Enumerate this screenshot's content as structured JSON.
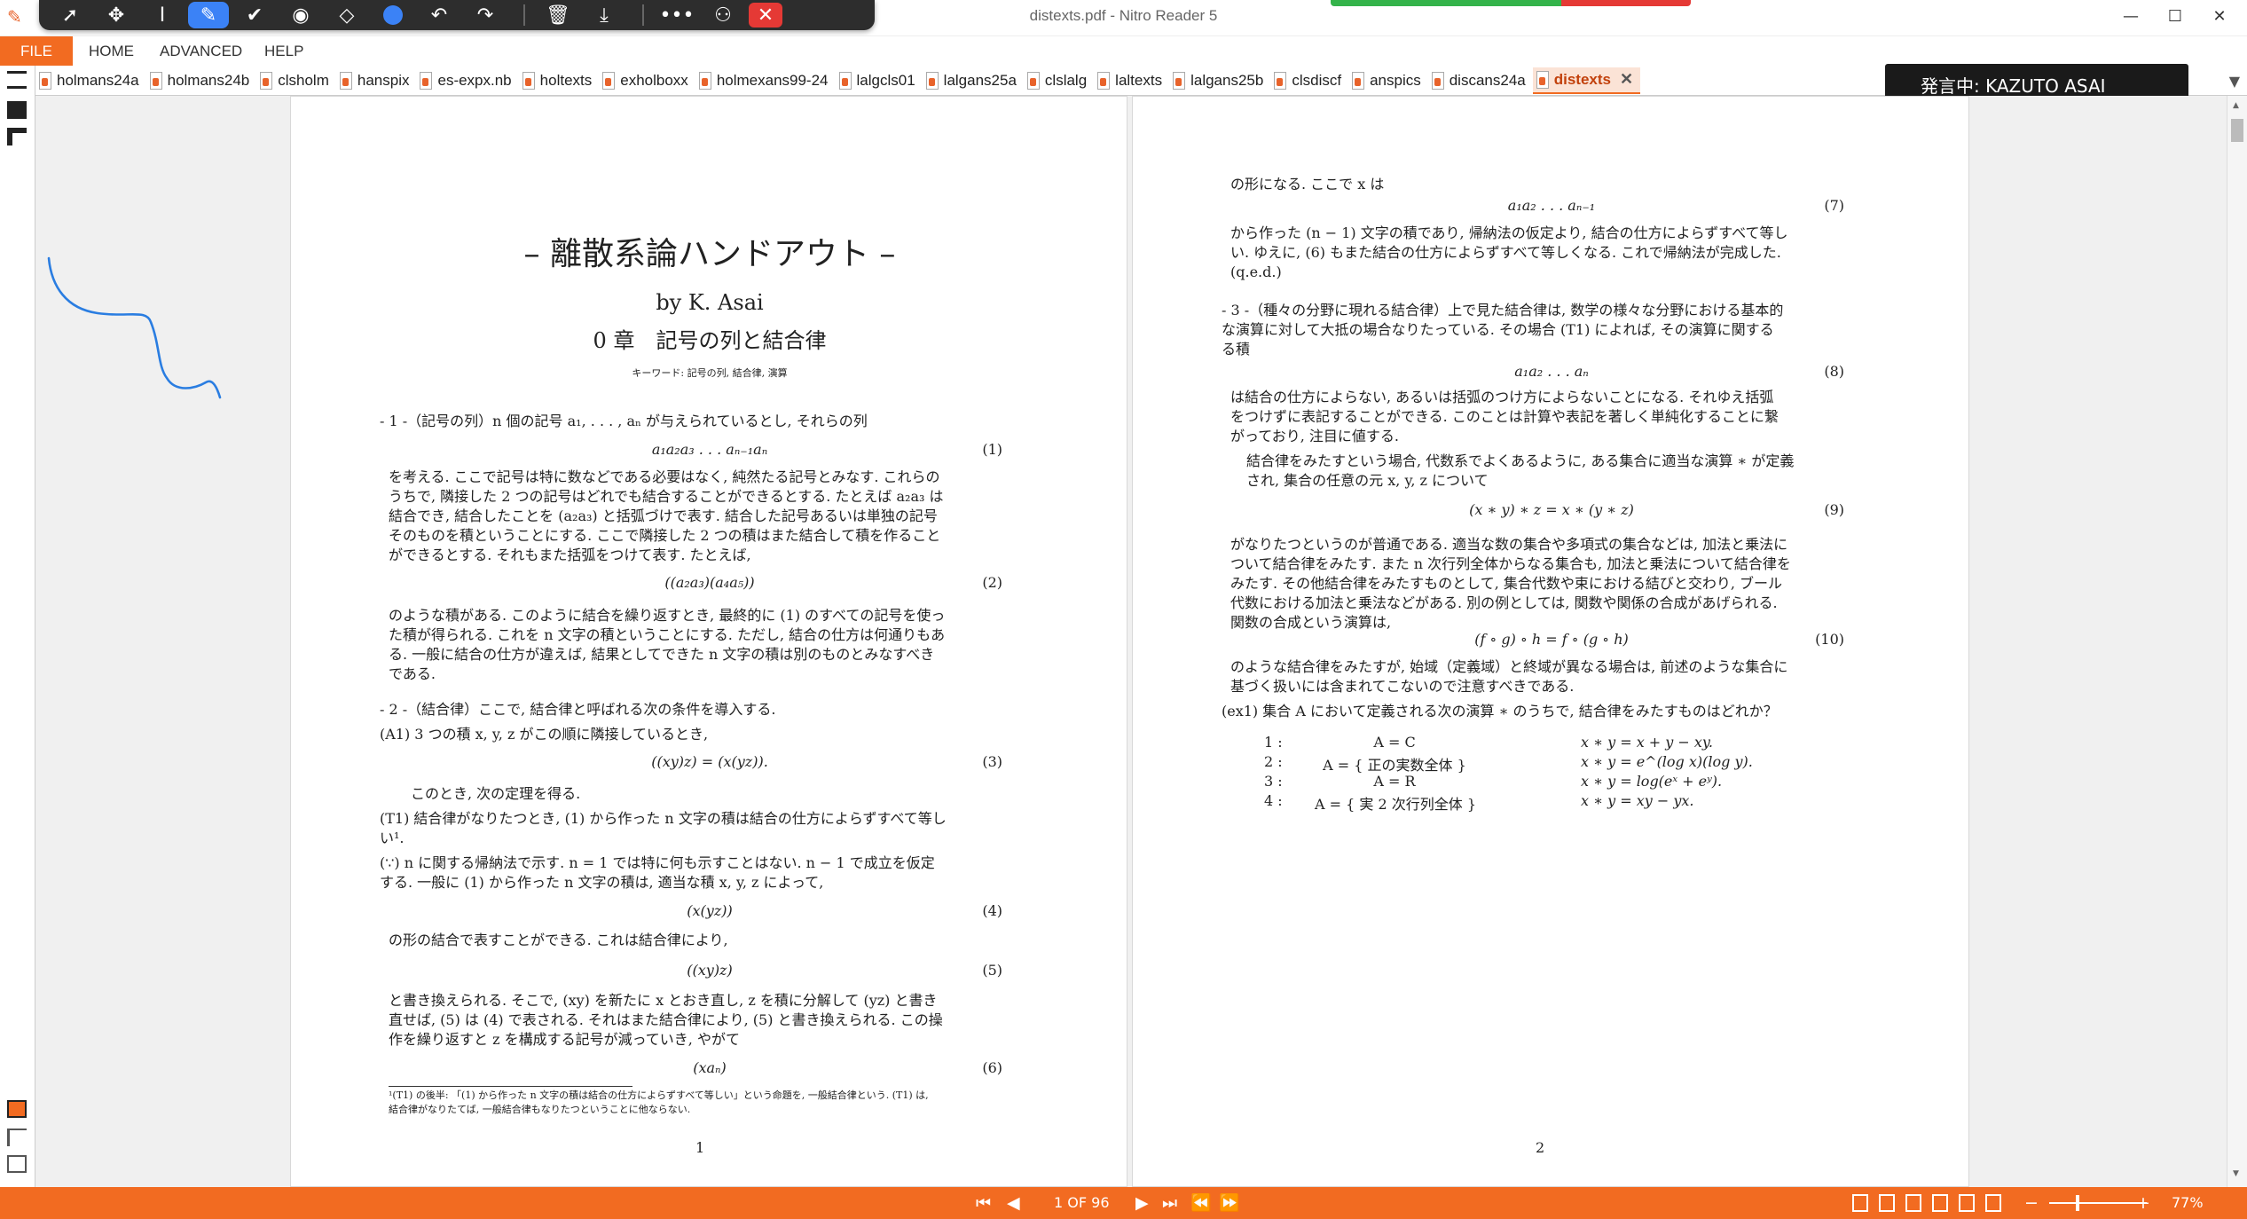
{
  "window": {
    "title": "distexts.pdf - Nitro Reader 5",
    "colors": {
      "accent": "#f26b21",
      "toolbar": "#2d2d2d",
      "green": "#34b34a",
      "red": "#e53935"
    }
  },
  "annotation_toolbar": {
    "tools": [
      "select-icon",
      "move-icon",
      "text-cursor-icon",
      "pen-icon",
      "check-icon",
      "stamp-icon",
      "eraser-icon",
      "color-icon",
      "undo-icon",
      "redo-icon",
      "trash-icon",
      "download-icon",
      "more-icon",
      "share-icon",
      "close-icon"
    ]
  },
  "menu": {
    "file": "FILE",
    "home": "HOME",
    "advanced": "ADVANCED",
    "help": "HELP"
  },
  "tabs": [
    {
      "label": "holmans24a"
    },
    {
      "label": "holmans24b"
    },
    {
      "label": "clsholm"
    },
    {
      "label": "hanspix"
    },
    {
      "label": "es-expx.nb"
    },
    {
      "label": "holtexts"
    },
    {
      "label": "exholboxx"
    },
    {
      "label": "holmexans99-24"
    },
    {
      "label": "lalgcls01"
    },
    {
      "label": "lalgans25a"
    },
    {
      "label": "clslalg"
    },
    {
      "label": "laltexts"
    },
    {
      "label": "lalgans25b"
    },
    {
      "label": "clsdiscf"
    },
    {
      "label": "anspics"
    },
    {
      "label": "discans24a"
    },
    {
      "label": "distexts",
      "active": true
    }
  ],
  "notification": {
    "text": "発言中: KAZUTO ASAI"
  },
  "page1": {
    "title": "– 離散系論ハンドアウト –",
    "author": "by K. Asai",
    "chapter": "0 章　記号の列と結合律",
    "keywords": "キーワード: 記号の列, 結合律, 演算",
    "s1_head": "- 1 -（記号の列）n 個の記号 a₁, . . . , aₙ が与えられているとし, それらの列",
    "eq1": "a₁a₂a₃ . . . aₙ₋₁aₙ",
    "eq1n": "(1)",
    "p1": [
      "を考える. ここで記号は特に数などである必要はなく, 純然たる記号とみなす. これらの",
      "うちで, 隣接した 2 つの記号はどれでも結合することができるとする. たとえば a₂a₃ は",
      "結合でき, 結合したことを (a₂a₃) と括弧づけで表す. 結合した記号あるいは単独の記号",
      "そのものを積ということにする. ここで隣接した 2 つの積はまた結合して積を作ること",
      "ができるとする. それもまた括弧をつけて表す. たとえば,"
    ],
    "eq2": "((a₂a₃)(a₄a₅))",
    "eq2n": "(2)",
    "p2": [
      "のような積がある. このように結合を繰り返すとき, 最終的に (1) のすべての記号を使っ",
      "た積が得られる. これを n 文字の積ということにする. ただし, 結合の仕方は何通りもあ",
      "る. 一般に結合の仕方が違えば, 結果としてできた n 文字の積は別のものとみなすべき",
      "である."
    ],
    "s2_head": "- 2 -（結合律）ここで, 結合律と呼ばれる次の条件を導入する.",
    "a1": "(A1) 3 つの積 x, y, z がこの順に隣接しているとき,",
    "eq3": "((xy)z) = (x(yz)).",
    "eq3n": "(3)",
    "then": "このとき, 次の定理を得る.",
    "t1": [
      "(T1) 結合律がなりたつとき, (1) から作った n 文字の積は結合の仕方によらずすべて等し",
      "い¹."
    ],
    "proof": [
      "(∵) n に関する帰納法で示す. n = 1 では特に何も示すことはない. n − 1 で成立を仮定",
      "する. 一般に (1) から作った n 文字の積は, 適当な積 x, y, z によって,"
    ],
    "eq4": "(x(yz))",
    "eq4n": "(4)",
    "p3": "の形の結合で表すことができる. これは結合律により,",
    "eq5": "((xy)z)",
    "eq5n": "(5)",
    "p4": [
      "と書き換えられる. そこで, (xy) を新たに x とおき直し, z を積に分解して (yz) と書き",
      "直せば, (5) は (4) で表される. それはまた結合律により, (5) と書き換えられる. この操",
      "作を繰り返すと z を構成する記号が減っていき, やがて"
    ],
    "eq6": "(xaₙ)",
    "eq6n": "(6)",
    "footnote": [
      "¹(T1) の後半: 「(1) から作った n 文字の積は結合の仕方によらずすべて等しい」という命題を, 一般結合律という. (T1) は,",
      "結合律がなりたてば, 一般結合律もなりたつということに他ならない."
    ],
    "page_number": "1"
  },
  "page2": {
    "p1": "の形になる. ここで x は",
    "eq7": "a₁a₂ . . . aₙ₋₁",
    "eq7n": "(7)",
    "p2": [
      "から作った (n − 1) 文字の積であり, 帰納法の仮定より, 結合の仕方によらずすべて等し",
      "い. ゆえに, (6) もまた結合の仕方によらずすべて等しくなる. これで帰納法が完成した.",
      "(q.e.d.)"
    ],
    "s3": [
      "- 3 -（種々の分野に現れる結合律）上で見た結合律は, 数学の様々な分野における基本的",
      "な演算に対して大抵の場合なりたっている. その場合 (T1) によれば, その演算に関する",
      "る積"
    ],
    "eq8": "a₁a₂ . . . aₙ",
    "eq8n": "(8)",
    "p3": [
      "は結合の仕方によらない, あるいは括弧のつけ方によらないことになる. それゆえ括弧",
      "をつけずに表記することができる. このことは計算や表記を著しく単純化することに繋",
      "がっており, 注目に値する."
    ],
    "p4": [
      "結合律をみたすという場合, 代数系でよくあるように, ある集合に適当な演算 ∗ が定義",
      "され, 集合の任意の元 x, y, z について"
    ],
    "eq9": "(x ∗ y) ∗ z = x ∗ (y ∗ z)",
    "eq9n": "(9)",
    "p5": [
      "がなりたつというのが普通である. 適当な数の集合や多項式の集合などは, 加法と乗法に",
      "ついて結合律をみたす. また n 次行列全体からなる集合も, 加法と乗法について結合律を",
      "みたす. その他結合律をみたすものとして, 集合代数や束における結びと交わり, ブール",
      "代数における加法と乗法などがある. 別の例としては, 関数や関係の合成があげられる.",
      "関数の合成という演算は,"
    ],
    "eq10": "(f ∘ g) ∘ h = f ∘ (g ∘ h)",
    "eq10n": "(10)",
    "p6": [
      "のような結合律をみたすが, 始域（定義域）と終域が異なる場合は, 前述のような集合に",
      "基づく扱いには含まれてこないので注意すべきである."
    ],
    "ex1": "(ex1) 集合 A において定義される次の演算 ∗ のうちで, 結合律をみたすものはどれか？",
    "ex_items": [
      {
        "num": "1 :",
        "set": "A = C",
        "op": "x ∗ y = x + y − xy."
      },
      {
        "num": "2 :",
        "set": "A = { 正の実数全体 }",
        "op": "x ∗ y = e^(log x)(log y)."
      },
      {
        "num": "3 :",
        "set": "A = R",
        "op": "x ∗ y = log(eˣ + eʸ)."
      },
      {
        "num": "4 :",
        "set": "A = { 実 2 次行列全体 }",
        "op": "x ∗ y = xy − yx."
      }
    ],
    "page_number": "2"
  },
  "status": {
    "page_indicator": "1 OF 96",
    "zoom": "77%"
  }
}
